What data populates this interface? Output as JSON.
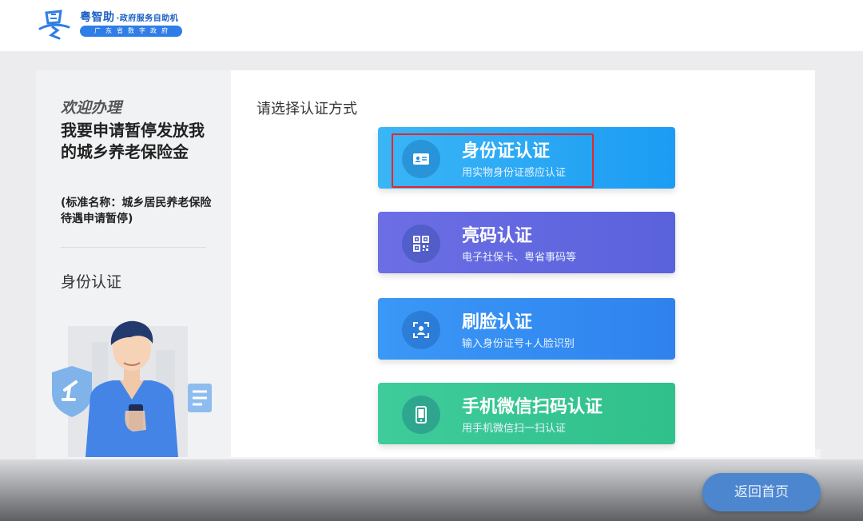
{
  "header": {
    "brand_name": "粤智助",
    "brand_subtitle": "·政府服务自助机",
    "brand_tagline": "广东省数字政府",
    "logo_icon": "yue-logo-icon"
  },
  "left_panel": {
    "welcome": "欢迎办理",
    "service_title": "我要申请暂停发放我的城乡养老保险金",
    "service_standard_name": "(标准名称：城乡居民养老保险待遇申请暂停)",
    "step_label": "身份认证"
  },
  "main": {
    "prompt": "请选择认证方式",
    "options": [
      {
        "title": "身份证认证",
        "subtitle": "用实物身份证感应认证",
        "icon": "id-card-icon",
        "color": "#1c9cf3",
        "highlighted": true
      },
      {
        "title": "亮码认证",
        "subtitle": "电子社保卡、粤省事码等",
        "icon": "qr-code-icon",
        "color": "#5a62dc"
      },
      {
        "title": "刷脸认证",
        "subtitle": "输入身份证号+人脸识别",
        "icon": "face-scan-icon",
        "color": "#2f82ee"
      },
      {
        "title": "手机微信扫码认证",
        "subtitle": "用手机微信扫一扫认证",
        "icon": "mobile-phone-icon",
        "color": "#30c08b"
      }
    ]
  },
  "footer": {
    "home_button": "返回首页"
  },
  "colors": {
    "highlight": "#e8262a",
    "brand": "#1a5fc4"
  }
}
